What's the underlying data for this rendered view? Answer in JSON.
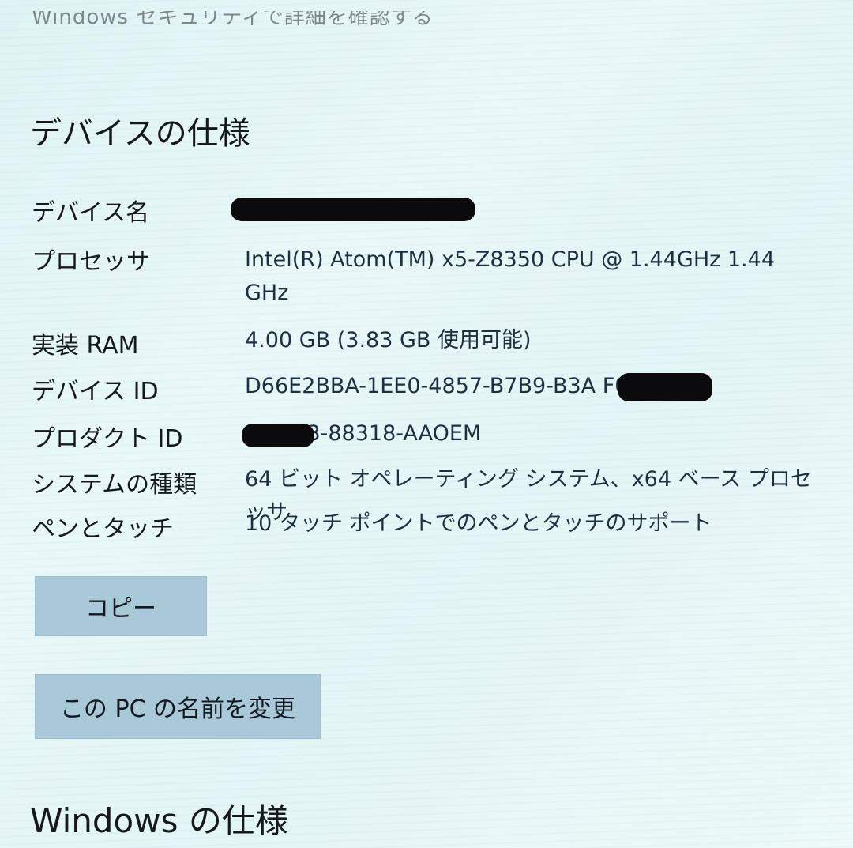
{
  "cutoff_text": "Windows セキュリティで詳細を確認する",
  "device_section": {
    "title": "デバイスの仕様",
    "rows": [
      {
        "label": "デバイス名",
        "value": ""
      },
      {
        "label": "プロセッサ",
        "value": "Intel(R) Atom(TM) x5-Z8350  CPU @ 1.44GHz   1.44 GHz"
      },
      {
        "label": "実装 RAM",
        "value": "4.00 GB (3.83 GB 使用可能)"
      },
      {
        "label": "デバイス ID",
        "value": "D66E2BBA-1EE0-4857-B7B9-B3A          F060"
      },
      {
        "label": "プロダクト ID",
        "value": "         -86383-88318-AAOEM"
      },
      {
        "label": "システムの種類",
        "value": "64 ビット オペレーティング システム、x64 ベース プロセッサ"
      },
      {
        "label": "ペンとタッチ",
        "value": "10 タッチ ポイントでのペンとタッチのサポート"
      }
    ],
    "copy_button": "コピー",
    "rename_button": "この PC の名前を変更"
  },
  "windows_section": {
    "title": "Windows の仕様"
  }
}
